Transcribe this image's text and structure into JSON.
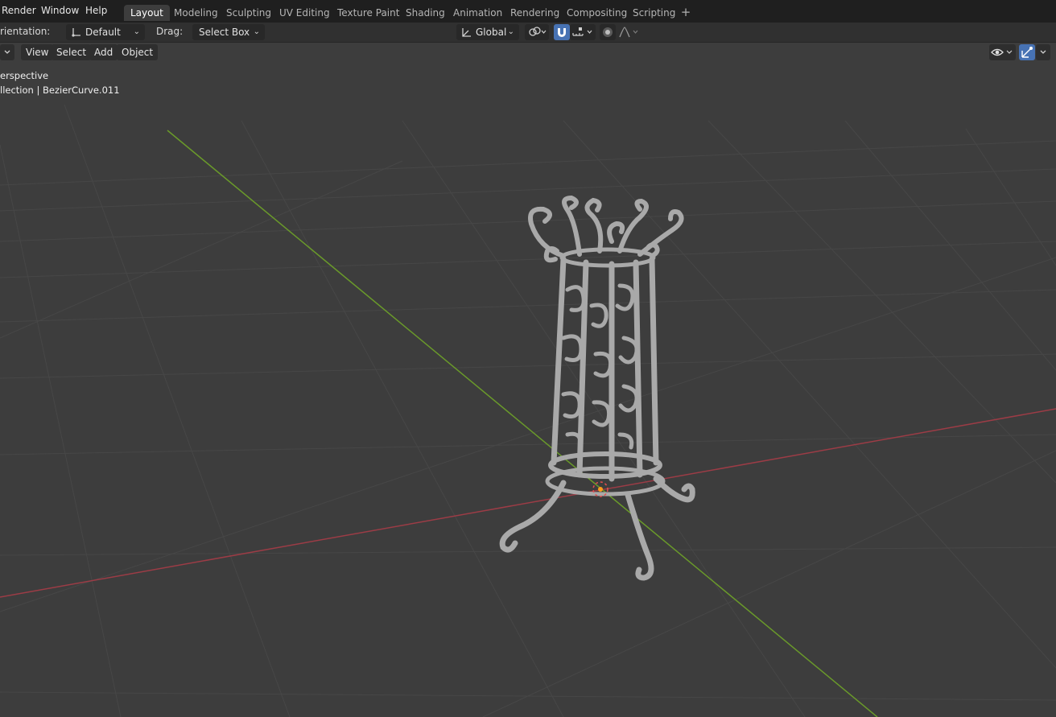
{
  "topbar": {
    "menus": [
      "Render",
      "Window",
      "Help"
    ],
    "workspace_tabs": [
      "Layout",
      "Modeling",
      "Sculpting",
      "UV Editing",
      "Texture Paint",
      "Shading",
      "Animation",
      "Rendering",
      "Compositing",
      "Scripting"
    ],
    "active_tab": "Layout",
    "add_tab": "+"
  },
  "toolheader": {
    "orientation_label": "rientation:",
    "orientation_value": "Default",
    "drag_label": "Drag:",
    "drag_value": "Select Box",
    "transform_orientation": "Global"
  },
  "viewport_header": {
    "menus": [
      "View",
      "Select",
      "Add",
      "Object"
    ]
  },
  "overlay": {
    "view_name": "erspective",
    "collection_info": "llection | BezierCurve.011"
  },
  "colors": {
    "viewport_bg": "#3d3d3d",
    "grid": "#4a4a4a",
    "x_axis": "#9c3c46",
    "y_axis": "#6a9a2a",
    "active_blue": "#4772b3",
    "model": "#a8a8a8"
  },
  "icons": [
    "orientation-gizmo-icon",
    "global-axes-icon",
    "pivot-link-icon",
    "snap-magnet-icon",
    "snap-increment-icon",
    "proportional-edit-icon",
    "falloff-curve-icon",
    "visibility-eye-icon",
    "gizmo-toggle-icon",
    "object-origin-icon"
  ]
}
